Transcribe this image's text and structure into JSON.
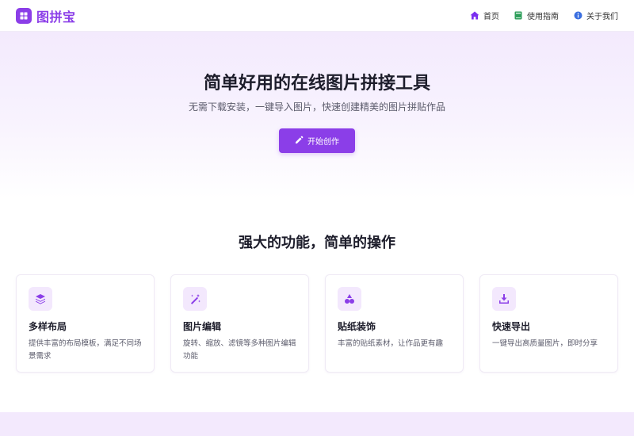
{
  "header": {
    "brand_name": "图拼宝",
    "nav": [
      {
        "label": "首页",
        "icon": "home-icon",
        "color": "#7b2ff0"
      },
      {
        "label": "使用指南",
        "icon": "book-icon",
        "color": "#2f9e5b"
      },
      {
        "label": "关于我们",
        "icon": "info-icon",
        "color": "#3b6fe0"
      }
    ]
  },
  "hero": {
    "title": "简单好用的在线图片拼接工具",
    "subtitle": "无需下载安装，一键导入图片，快速创建精美的图片拼贴作品",
    "cta_label": "开始创作"
  },
  "features": {
    "title": "强大的功能，简单的操作",
    "cards": [
      {
        "icon": "layers-icon",
        "title": "多样布局",
        "desc": "提供丰富的布局模板，满足不同场景需求"
      },
      {
        "icon": "magic-wand-icon",
        "title": "图片编辑",
        "desc": "旋转、缩放、滤镜等多种图片编辑功能"
      },
      {
        "icon": "shapes-icon",
        "title": "贴纸装饰",
        "desc": "丰富的贴纸素材，让作品更有趣"
      },
      {
        "icon": "download-icon",
        "title": "快速导出",
        "desc": "一键导出高质量图片，即时分享"
      }
    ]
  },
  "colors": {
    "accent": "#8b3ee8",
    "hero_bg": "#f3eafd",
    "icon_bg": "#f3e8fd"
  }
}
